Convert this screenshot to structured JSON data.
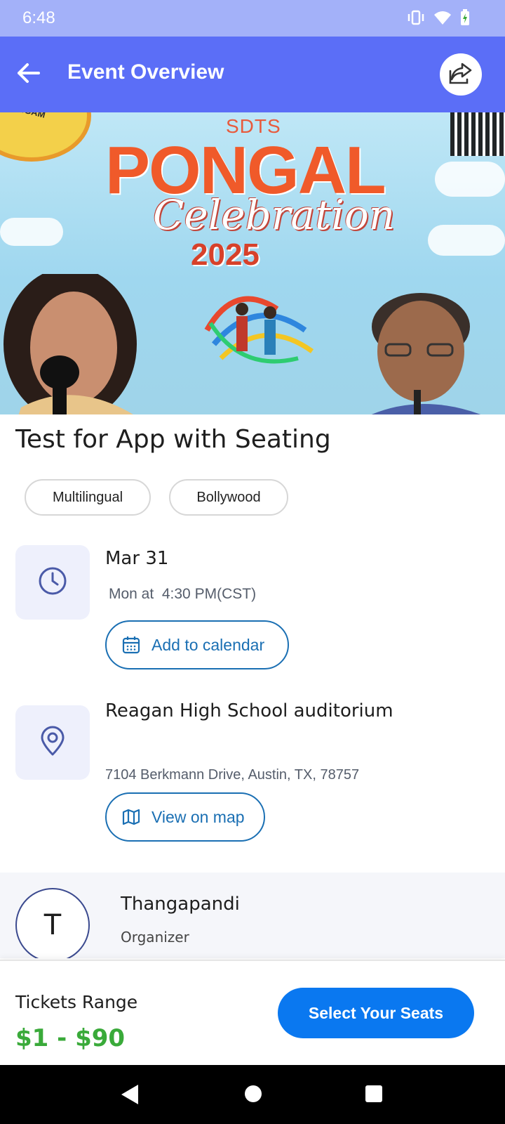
{
  "status_bar": {
    "time": "6:48",
    "icons": [
      "vibrate-icon",
      "wifi-icon",
      "battery-charging-icon"
    ]
  },
  "app_bar": {
    "title": "Event Overview",
    "back_icon": "arrow-left-icon",
    "share_icon": "share-icon",
    "background_color": "#5b6ef7"
  },
  "banner": {
    "org_text": "SDTS",
    "title": "PONGAL",
    "subtitle": "Celebration",
    "year": "2025",
    "badge_text": "TAMIL SANGAM"
  },
  "event": {
    "title": "Test for App with Seating",
    "tags": [
      "Multilingual",
      "Bollywood"
    ]
  },
  "schedule": {
    "date": "Mar 31",
    "time_line": "Mon at  4:30 PM(CST)",
    "calendar_button": "Add to calendar"
  },
  "venue": {
    "name": "Reagan High School auditorium",
    "address": "7104 Berkmann Drive, Austin, TX, 78757",
    "map_button": "View on map"
  },
  "organizer": {
    "initial": "T",
    "name": "Thangapandi",
    "role": "Organizer"
  },
  "tickets": {
    "label": "Tickets Range",
    "range": "$1 - $90",
    "cta": "Select Your Seats",
    "price_color": "#3aaa3a",
    "cta_color": "#0a78f0"
  }
}
